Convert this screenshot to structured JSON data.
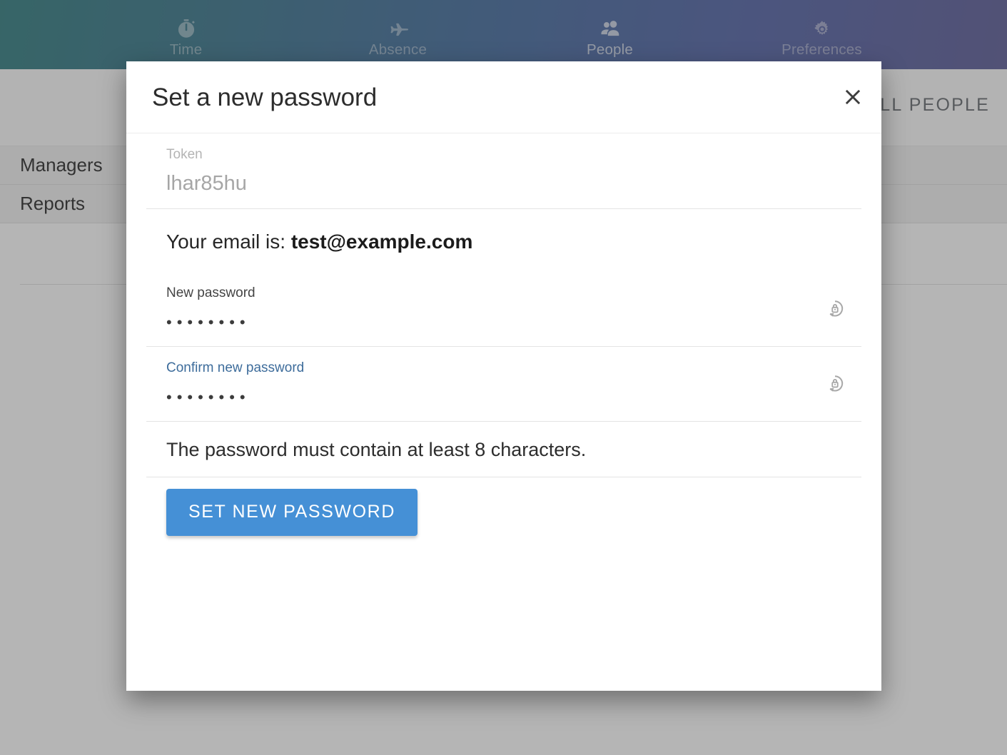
{
  "topnav": {
    "items": [
      {
        "label": "Time",
        "icon": "stopwatch-icon",
        "state": "dim"
      },
      {
        "label": "Absence",
        "icon": "airplane-icon",
        "state": "dim"
      },
      {
        "label": "People",
        "icon": "people-group-icon",
        "state": "active"
      },
      {
        "label": "Preferences",
        "icon": "gear-icon",
        "state": "dim"
      }
    ]
  },
  "subheader": {
    "all_people_label": "ALL PEOPLE"
  },
  "background_list": {
    "rows": [
      {
        "label": "Managers"
      },
      {
        "label": "Reports"
      }
    ]
  },
  "dialog": {
    "title": "Set a new password",
    "close_icon": "close-icon",
    "token_field": {
      "label": "Token",
      "value": "lhar85hu"
    },
    "email_prefix": "Your email is: ",
    "email_value": "test@example.com",
    "new_password_field": {
      "label": "New password",
      "value": "••••••••",
      "action_icon": "reset-password-lock-icon"
    },
    "confirm_password_field": {
      "label": "Confirm new password",
      "value": "••••••••",
      "action_icon": "reset-password-lock-icon"
    },
    "hint": "The password must contain at least 8 characters.",
    "submit_label": "SET NEW PASSWORD"
  },
  "colors": {
    "primary_button": "#4590d6",
    "focused_label": "#3d6c9b",
    "nav_gradient_start": "#1a6e72",
    "nav_gradient_end": "#4b4b8c",
    "disabled_text": "#a6a6a6"
  }
}
